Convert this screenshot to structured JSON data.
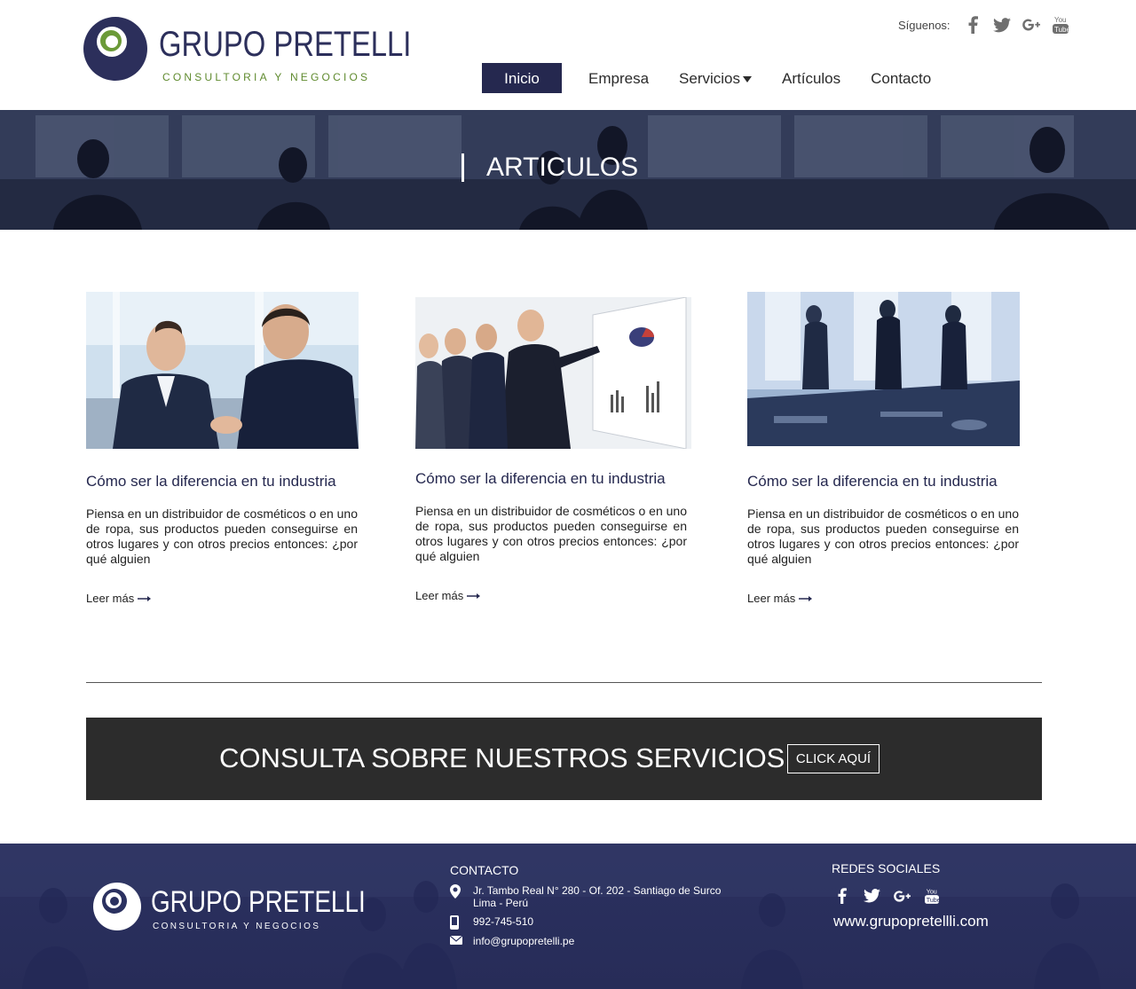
{
  "header": {
    "logo": {
      "name": "GRUPO PRETELLI",
      "tagline": "CONSULTORIA Y NEGOCIOS"
    },
    "social": {
      "label": "Síguenos:",
      "icons": [
        "facebook-icon",
        "twitter-icon",
        "google-plus-icon",
        "youtube-icon"
      ]
    },
    "nav": [
      {
        "label": "Inicio",
        "active": true
      },
      {
        "label": "Empresa"
      },
      {
        "label": "Servicios"
      },
      {
        "label": "Artículos"
      },
      {
        "label": "Contacto"
      }
    ]
  },
  "banner": {
    "title": "ARTICULOS"
  },
  "articles": [
    {
      "title": "Cómo ser la diferencia en tu industria",
      "excerpt": "Piensa en un distribuidor de cosméticos o en uno de ropa, sus productos pueden conseguirse en otros lugares y con otros precios entonces: ¿por qué alguien",
      "more": "Leer más"
    },
    {
      "title": "Cómo ser la diferencia en tu industria",
      "excerpt": "Piensa en un distribuidor de cosméticos o en uno de ropa, sus productos pueden conseguirse en otros lugares y con otros precios entonces: ¿por qué alguien",
      "more": "Leer más"
    },
    {
      "title": "Cómo ser la diferencia en tu industria",
      "excerpt": "Piensa en un distribuidor de cosméticos o en uno de ropa, sus productos pueden conseguirse en otros lugares y con otros precios entonces: ¿por qué alguien",
      "more": "Leer más"
    }
  ],
  "cta": {
    "text": "CONSULTA SOBRE NUESTROS SERVICIOS",
    "button": "CLICK AQUÍ"
  },
  "footer": {
    "logo": {
      "name": "GRUPO PRETELLI",
      "tagline": "CONSULTORIA Y NEGOCIOS"
    },
    "contact": {
      "heading": "CONTACTO",
      "address_line1": "Jr. Tambo Real N° 280 - Of. 202 - Santiago de Surco",
      "address_line2": "Lima - Perú",
      "phone": "992-745-510",
      "email": "info@grupopretelli.pe"
    },
    "social": {
      "heading": "REDES SOCIALES",
      "website": "www.grupopretellli.com"
    }
  },
  "colors": {
    "brand_navy": "#25284f",
    "brand_green": "#5f8a2e",
    "cta_bg": "#2c2c2c",
    "footer_bg": "#2b3160"
  }
}
